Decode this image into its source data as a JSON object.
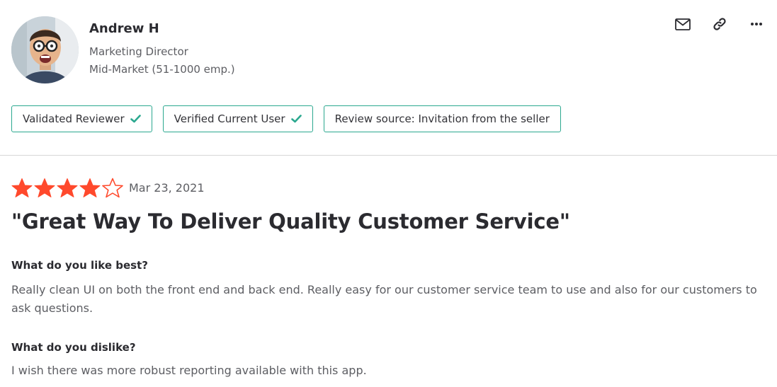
{
  "reviewer": {
    "name": "Andrew H",
    "job_title": "Marketing Director",
    "segment": "Mid-Market (51-1000 emp.)"
  },
  "actions": {
    "mail_icon": "envelope-icon",
    "link_icon": "link-icon",
    "more_icon": "more-dots-icon"
  },
  "badges": [
    {
      "label": "Validated Reviewer",
      "checked": true
    },
    {
      "label": "Verified Current User",
      "checked": true
    },
    {
      "label": "Review source: Invitation from the seller",
      "checked": false
    }
  ],
  "review": {
    "rating": 4,
    "rating_max": 5,
    "date": "Mar 23, 2021",
    "title": "\"Great Way To Deliver Quality Customer Service\"",
    "questions": [
      {
        "question": "What do you like best?",
        "answer": "Really clean UI on both the front end and back end. Really easy for our customer service team to use and also for our customers to ask questions."
      },
      {
        "question": "What do you dislike?",
        "answer": "I wish there was more robust reporting available with this app."
      }
    ]
  },
  "colors": {
    "star": "#ff492c",
    "badge_border": "#2ba88f",
    "check": "#2ba88f",
    "text": "#2b2b30",
    "muted": "#5d5e63",
    "divider": "#d6d6d6"
  }
}
